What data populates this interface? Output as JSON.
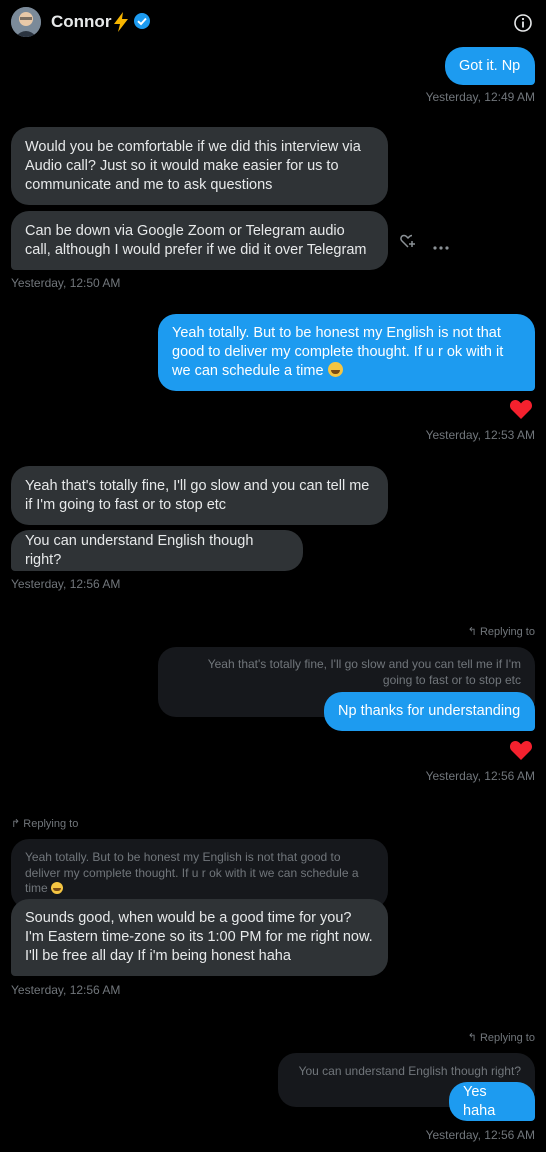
{
  "header": {
    "name": "Connor",
    "emoji_icon": "lightning-bolt-icon",
    "verified_icon": "verified-badge-icon",
    "info_icon": "info-icon"
  },
  "messages": {
    "m1": {
      "text": "Got it. Np",
      "time": "Yesterday, 12:49 AM"
    },
    "m2": {
      "text": "Would you be comfortable if we did this interview via Audio call? Just so it would make easier for us to communicate and me to ask questions"
    },
    "m3": {
      "text": "Can be down via Google Zoom or Telegram audio call, although I would prefer if we did it over Telegram",
      "time": "Yesterday, 12:50 AM"
    },
    "m4": {
      "text": "Yeah totally. But to be honest my English is not that good to deliver my complete thought. If u r ok with it we can schedule a time",
      "time": "Yesterday, 12:53 AM"
    },
    "m5": {
      "text": "Yeah that's totally fine, I'll go slow and you can tell me if I'm going to fast or to stop etc"
    },
    "m6": {
      "text": "You can understand English though right?",
      "time": "Yesterday, 12:56 AM"
    },
    "m7": {
      "reply_label": "Replying to",
      "quoted": "Yeah that's totally fine, I'll go slow and you can tell me if I'm going to fast or to stop etc",
      "text": "Np thanks for understanding",
      "time": "Yesterday, 12:56 AM"
    },
    "m8": {
      "reply_label": "Replying to",
      "quoted": "Yeah totally. But to be honest my English is not that good to deliver my complete thought. If u r ok with it we can schedule a time",
      "text": "Sounds good, when would be a good time for you? I'm Eastern time-zone so its 1:00 PM for me right now. I'll be free all day If i'm being honest haha",
      "time": "Yesterday, 12:56 AM"
    },
    "m9": {
      "reply_label": "Replying to",
      "quoted": "You can understand English though right?",
      "text": "Yes haha",
      "time": "Yesterday, 12:56 AM"
    }
  },
  "colors": {
    "outgoing": "#1d9bf0",
    "incoming": "#2f3336",
    "heart": "#f4212e",
    "timestamp": "#71767b"
  }
}
